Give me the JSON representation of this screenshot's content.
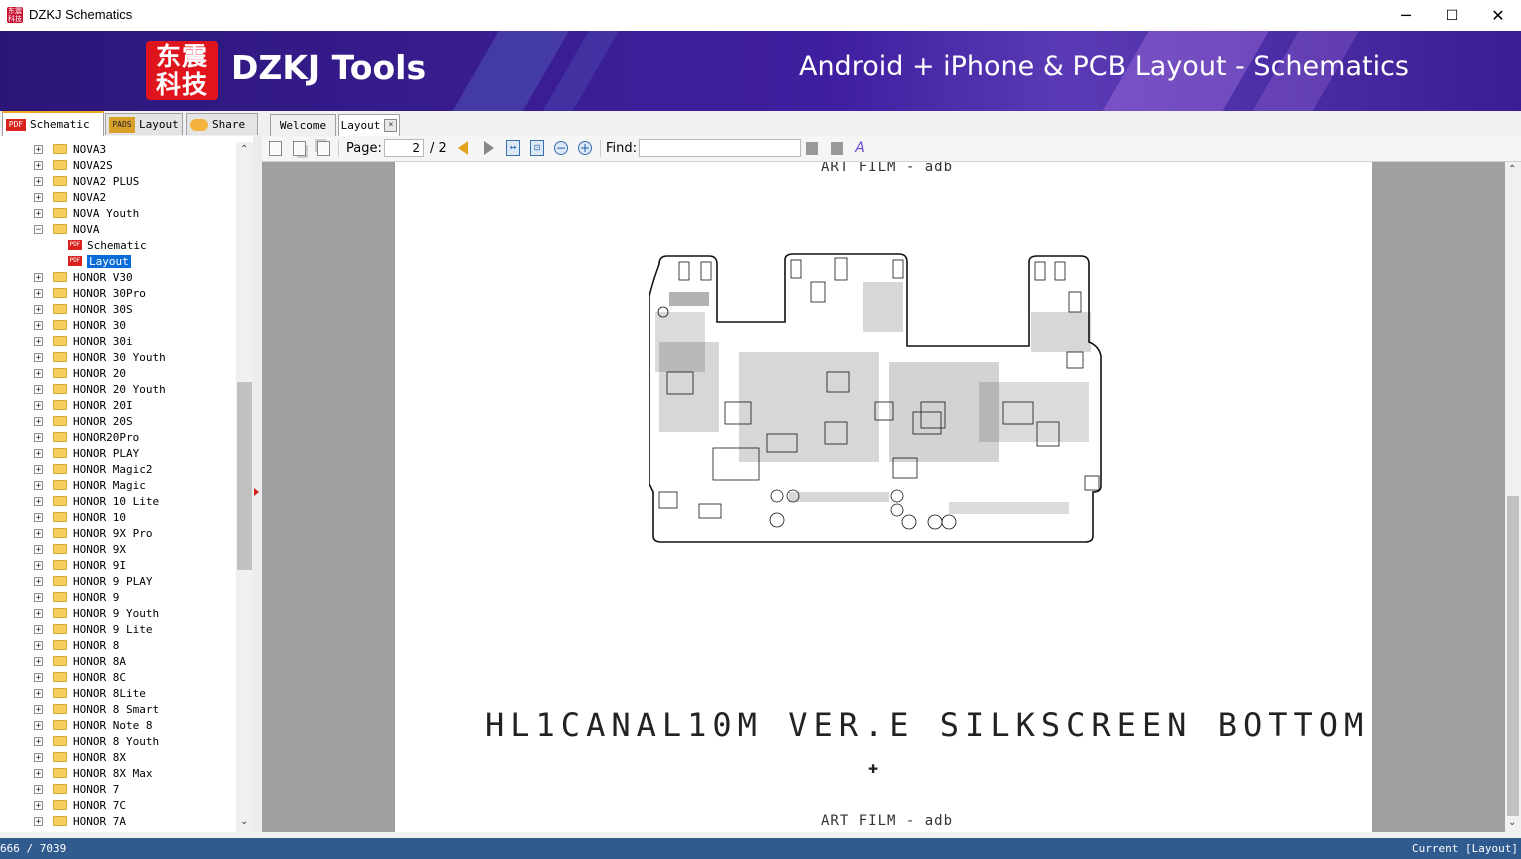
{
  "window": {
    "title": "DZKJ Schematics",
    "minimize": "─",
    "maximize": "☐",
    "close": "✕"
  },
  "banner": {
    "logo_text": "东震科技",
    "brand": "DZKJ Tools",
    "tagline": "Android + iPhone & PCB Layout - Schematics"
  },
  "left_tabs": [
    {
      "label": "Schematic",
      "icon": "PDF"
    },
    {
      "label": "Layout",
      "icon": "PADS"
    },
    {
      "label": "Share",
      "icon": "share"
    }
  ],
  "doc_tabs": [
    {
      "label": "Welcome"
    },
    {
      "label": "Layout"
    }
  ],
  "tree": [
    {
      "label": "NOVA3",
      "type": "folder",
      "level": 0,
      "expander": "+"
    },
    {
      "label": "NOVA2S",
      "type": "folder",
      "level": 0,
      "expander": "+"
    },
    {
      "label": "NOVA2 PLUS",
      "type": "folder",
      "level": 0,
      "expander": "+"
    },
    {
      "label": "NOVA2",
      "type": "folder",
      "level": 0,
      "expander": "+"
    },
    {
      "label": "NOVA Youth",
      "type": "folder",
      "level": 0,
      "expander": "+"
    },
    {
      "label": "NOVA",
      "type": "folder",
      "level": 0,
      "expander": "−"
    },
    {
      "label": "Schematic",
      "type": "pdf",
      "level": 1
    },
    {
      "label": "Layout",
      "type": "pdf",
      "level": 1,
      "selected": true
    },
    {
      "label": "HONOR V30",
      "type": "folder",
      "level": 0,
      "expander": "+"
    },
    {
      "label": "HONOR 30Pro",
      "type": "folder",
      "level": 0,
      "expander": "+"
    },
    {
      "label": "HONOR 30S",
      "type": "folder",
      "level": 0,
      "expander": "+"
    },
    {
      "label": "HONOR 30",
      "type": "folder",
      "level": 0,
      "expander": "+"
    },
    {
      "label": "HONOR 30i",
      "type": "folder",
      "level": 0,
      "expander": "+"
    },
    {
      "label": "HONOR 30 Youth",
      "type": "folder",
      "level": 0,
      "expander": "+"
    },
    {
      "label": "HONOR 20",
      "type": "folder",
      "level": 0,
      "expander": "+"
    },
    {
      "label": "HONOR 20 Youth",
      "type": "folder",
      "level": 0,
      "expander": "+"
    },
    {
      "label": "HONOR 20I",
      "type": "folder",
      "level": 0,
      "expander": "+"
    },
    {
      "label": "HONOR 20S",
      "type": "folder",
      "level": 0,
      "expander": "+"
    },
    {
      "label": "HONOR20Pro",
      "type": "folder",
      "level": 0,
      "expander": "+"
    },
    {
      "label": "HONOR PLAY",
      "type": "folder",
      "level": 0,
      "expander": "+"
    },
    {
      "label": "HONOR Magic2",
      "type": "folder",
      "level": 0,
      "expander": "+"
    },
    {
      "label": "HONOR Magic",
      "type": "folder",
      "level": 0,
      "expander": "+"
    },
    {
      "label": "HONOR 10 Lite",
      "type": "folder",
      "level": 0,
      "expander": "+"
    },
    {
      "label": "HONOR 10",
      "type": "folder",
      "level": 0,
      "expander": "+"
    },
    {
      "label": "HONOR 9X Pro",
      "type": "folder",
      "level": 0,
      "expander": "+"
    },
    {
      "label": "HONOR 9X",
      "type": "folder",
      "level": 0,
      "expander": "+"
    },
    {
      "label": "HONOR 9I",
      "type": "folder",
      "level": 0,
      "expander": "+"
    },
    {
      "label": "HONOR 9 PLAY",
      "type": "folder",
      "level": 0,
      "expander": "+"
    },
    {
      "label": "HONOR 9",
      "type": "folder",
      "level": 0,
      "expander": "+"
    },
    {
      "label": "HONOR 9 Youth",
      "type": "folder",
      "level": 0,
      "expander": "+"
    },
    {
      "label": "HONOR 9 Lite",
      "type": "folder",
      "level": 0,
      "expander": "+"
    },
    {
      "label": "HONOR 8",
      "type": "folder",
      "level": 0,
      "expander": "+"
    },
    {
      "label": "HONOR 8A",
      "type": "folder",
      "level": 0,
      "expander": "+"
    },
    {
      "label": "HONOR 8C",
      "type": "folder",
      "level": 0,
      "expander": "+"
    },
    {
      "label": "HONOR 8Lite",
      "type": "folder",
      "level": 0,
      "expander": "+"
    },
    {
      "label": "HONOR 8 Smart",
      "type": "folder",
      "level": 0,
      "expander": "+"
    },
    {
      "label": "HONOR Note 8",
      "type": "folder",
      "level": 0,
      "expander": "+"
    },
    {
      "label": "HONOR 8 Youth",
      "type": "folder",
      "level": 0,
      "expander": "+"
    },
    {
      "label": "HONOR 8X",
      "type": "folder",
      "level": 0,
      "expander": "+"
    },
    {
      "label": "HONOR 8X Max",
      "type": "folder",
      "level": 0,
      "expander": "+"
    },
    {
      "label": "HONOR 7",
      "type": "folder",
      "level": 0,
      "expander": "+"
    },
    {
      "label": "HONOR 7C",
      "type": "folder",
      "level": 0,
      "expander": "+"
    },
    {
      "label": "HONOR 7A",
      "type": "folder",
      "level": 0,
      "expander": "+"
    }
  ],
  "toolbar": {
    "page_label": "Page:",
    "page_value": "2",
    "page_total": "/ 2",
    "find_label": "Find:",
    "find_value": ""
  },
  "document": {
    "header": "ART FILM - adb",
    "footer": "ART FILM - adb",
    "silkscreen_title": "HL1CANAL10M VER.E SILKSCREEN BOTTOM"
  },
  "status": {
    "left": "666 / 7039",
    "right": "Current [Layout]"
  }
}
